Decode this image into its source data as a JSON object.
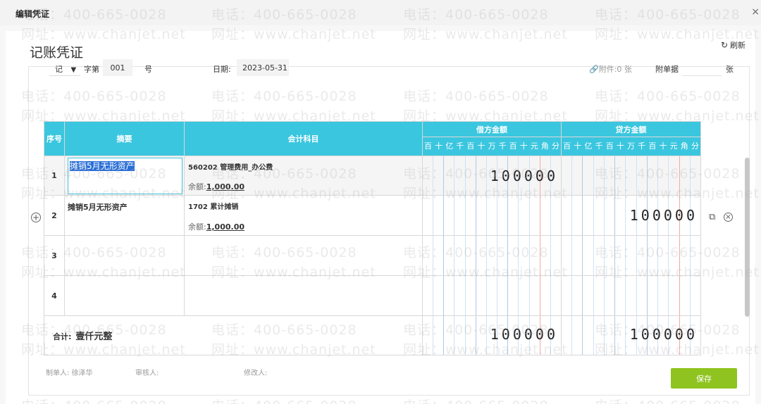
{
  "window": {
    "title": "编辑凭证",
    "close_glyph": "×"
  },
  "watermark": {
    "phone": "电话：400-665-0028",
    "site": "网址：www.chanjet.net"
  },
  "page": {
    "title": "记账凭证",
    "refresh_label": "刷新",
    "refresh_icon": "refresh-icon"
  },
  "voucher_meta": {
    "word": "记",
    "word_suffix": "字第",
    "number": "001",
    "number_suffix": "号",
    "date_label": "日期:",
    "date_value": "2023-05-31",
    "attachment_link": "附件:0 张",
    "attach_label": "附单据",
    "attach_unit": "张"
  },
  "table": {
    "headers": {
      "seq": "序号",
      "summary": "摘要",
      "account": "会计科目",
      "debit": "借方金额",
      "credit": "贷方金额"
    },
    "digit_units": [
      "百",
      "十",
      "亿",
      "千",
      "百",
      "十",
      "万",
      "千",
      "百",
      "十",
      "元",
      "角",
      "分"
    ],
    "rows": [
      {
        "seq": "1",
        "summary": "摊销5月无形资产",
        "account": "560202 管理费用_办公费",
        "balance_label": "余额:",
        "balance": "1,000.00",
        "debit": "100000",
        "credit": ""
      },
      {
        "seq": "2",
        "summary": "摊销5月无形资产",
        "account": "1702 累计摊销",
        "balance_label": "余额:",
        "balance": "1,000.00",
        "debit": "",
        "credit": "100000"
      },
      {
        "seq": "3",
        "summary": "",
        "account": "",
        "balance_label": "",
        "balance": "",
        "debit": "",
        "credit": ""
      },
      {
        "seq": "4",
        "summary": "",
        "account": "",
        "balance_label": "",
        "balance": "",
        "debit": "",
        "credit": ""
      }
    ],
    "total": {
      "label": "合计:",
      "amount_words": "壹仟元整",
      "debit": "100000",
      "credit": "100000"
    }
  },
  "footer": {
    "maker_label": "制单人:",
    "maker": "徐泽华",
    "reviewer_label": "审核人:",
    "reviewer": "",
    "modifier_label": "修改人:",
    "modifier": ""
  },
  "actions": {
    "save_label": "保存"
  },
  "colors": {
    "header_bg": "#3bc6df",
    "save_bg": "#8fc31f",
    "selection": "#2a6fd6"
  }
}
